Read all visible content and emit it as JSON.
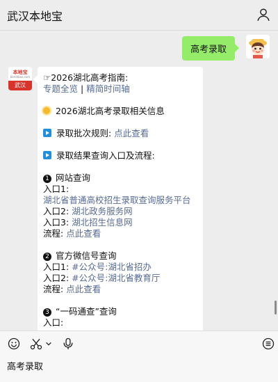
{
  "header": {
    "title": "武汉本地宝",
    "profile_icon": "person-icon"
  },
  "user_message": {
    "text": "高考录取"
  },
  "bot_avatar": {
    "logo_text": "本地宝",
    "logo_sub": "bendibao.com",
    "city": "武汉"
  },
  "bot_message": {
    "guide_prefix": "☞2026湖北高考指南:",
    "link_topics": "专题全览",
    "separator": "|",
    "link_timeline": "精简时间轴",
    "section_title": "2026湖北高考录取相关信息",
    "rules_label": "录取批次规则:",
    "rules_link": "点此查看",
    "result_label": "录取结果查询入口及流程:",
    "website_title": "网站查询",
    "entry1_label": "入口1:",
    "entry1_link": "湖北省普通高校招生录取查询服务平台",
    "entry2_label": "入口2:",
    "entry2_link": "湖北政务服务网",
    "entry3_label": "入口3:",
    "entry3_link": "湖北招生信息网",
    "flow_label": "流程:",
    "flow_link": "点此查看",
    "wechat_title": "官方微信号查询",
    "wx1_label": "入口1:",
    "wx1_link": "#公众号:湖北省招办",
    "wx2_label": "入口2:",
    "wx2_link": "#公众号:湖北省教育厅",
    "wx_flow_label": "流程:",
    "wx_flow_link": "点此查看",
    "code_title": "“一码通查”查询",
    "code_entry_label": "入口:"
  },
  "input_bar": {
    "draft_text": "高考录取",
    "icons": [
      "emoji-icon",
      "scissors-icon",
      "chevron-down-icon",
      "microphone-icon",
      "keyboard-menu-icon"
    ]
  },
  "colors": {
    "bubble_user": "#95ec69",
    "link": "#576b95",
    "brand_red": "#d9342b"
  }
}
